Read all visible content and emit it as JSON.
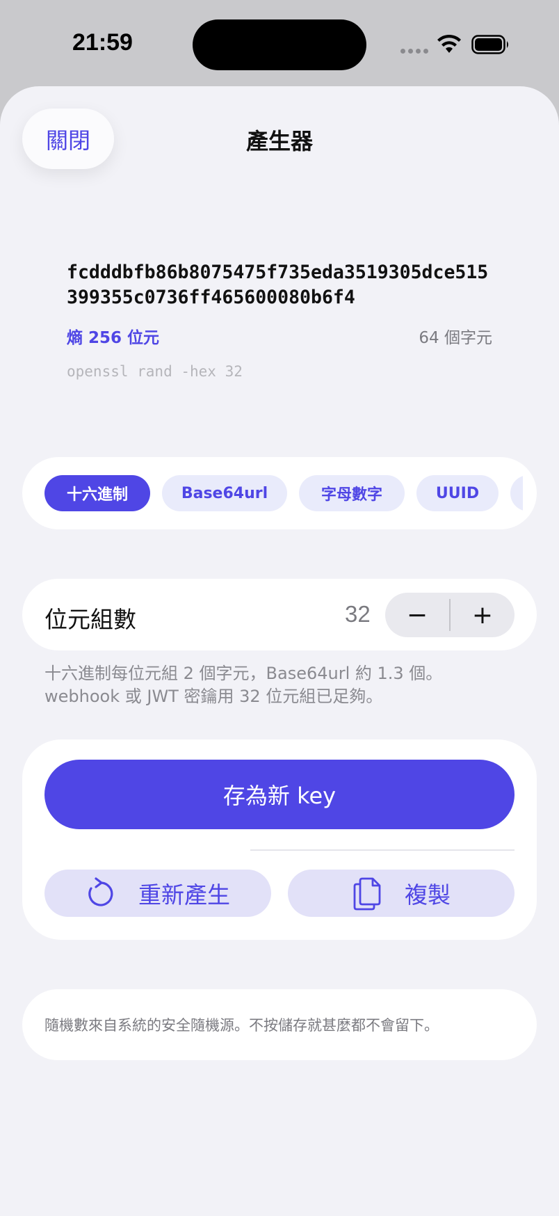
{
  "status_bar": {
    "time": "21:59"
  },
  "header": {
    "close_label": "關閉",
    "title": "產生器"
  },
  "key": {
    "value": "fcdddbfb86b8075475f735eda3519305dce515399355c0736ff465600080b6f4",
    "entropy": "熵 256 位元",
    "char_count": "64 個字元",
    "command": "openssl rand -hex 32"
  },
  "formats": [
    {
      "label": "十六進制",
      "active": true
    },
    {
      "label": "Base64url",
      "active": false
    },
    {
      "label": "字母數字",
      "active": false
    },
    {
      "label": "UUID",
      "active": false
    },
    {
      "label": "",
      "active": false
    }
  ],
  "bytes": {
    "label": "位元組數",
    "value": "32",
    "decrement": "−",
    "increment": "+"
  },
  "hint": {
    "line1": "十六進制每位元組 2 個字元，Base64url 約 1.3 個。",
    "line2": "webhook 或 JWT 密鑰用 32 位元組已足夠。"
  },
  "actions": {
    "save_label": "存為新 key",
    "regenerate_label": "重新產生",
    "copy_label": "複製"
  },
  "footer": {
    "note": "隨機數來自系統的安全隨機源。不按儲存就甚麼都不會留下。"
  },
  "colors": {
    "accent": "#4f46e5",
    "accent_soft": "#e2e1f8",
    "background": "#f2f2f7"
  }
}
